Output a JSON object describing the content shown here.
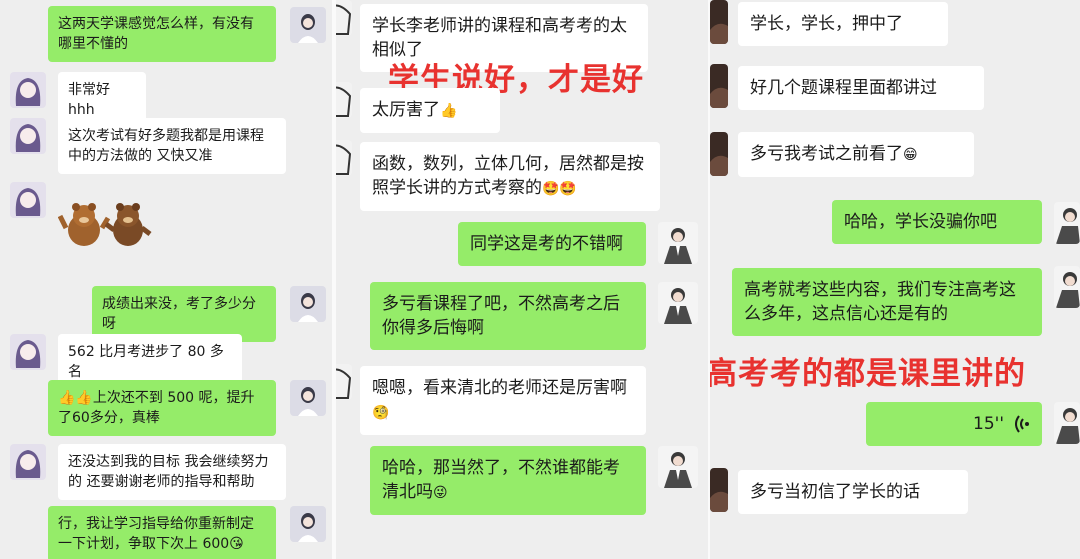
{
  "panel1": {
    "m1": "这两天学课感觉怎么样，有没有哪里不懂的",
    "m2": "非常好 hhh",
    "m3": "这次考试有好多题我都是用课程中的方法做的 又快又准",
    "m4": "成绩出来没，考了多少分呀",
    "m5": "562 比月考进步了 80 多名",
    "m6_emoji": "👍👍",
    "m6": "上次还不到 500 呢，提升了60多分，真棒",
    "m7": "还没达到我的目标 我会继续努力的 还要谢谢老师的指导和帮助",
    "m8": "行，我让学习指导给你重新制定一下计划，争取下次上 600",
    "m8_emoji": "😘"
  },
  "panel2": {
    "m1": "学长李老师讲的课程和高考考的太相似了",
    "caption": "学生说好，才是好",
    "m2": "太厉害了",
    "m2_emoji": "👍",
    "m3": "函数，数列，立体几何，居然都是按照学长讲的方式考察的",
    "m3_emoji": "🤩🤩",
    "m4": "同学这是考的不错啊",
    "m5": "多亏看课程了吧，不然高考之后你得多后悔啊",
    "m6": "嗯嗯，看来清北的老师还是厉害啊",
    "m6_emoji": "🧐",
    "m7": "哈哈，那当然了，不然谁都能考清北吗",
    "m7_emoji": "😜"
  },
  "panel3": {
    "m1": "学长，学长，押中了",
    "m2": "好几个题课程里面都讲过",
    "m3": "多亏我考试之前看了",
    "m3_emoji": "😁",
    "m4": "哈哈，学长没骗你吧",
    "m5": "高考就考这些内容，我们专注高考这么多年，这点信心还是有的",
    "caption": "高考考的都是课里讲的",
    "voice_duration": "15''",
    "m6": "多亏当初信了学长的话"
  },
  "colors": {
    "sent_bubble": "#95ec69",
    "received_bubble": "#ffffff",
    "caption_red": "#e8322f",
    "chat_background": "#eeeeee"
  }
}
